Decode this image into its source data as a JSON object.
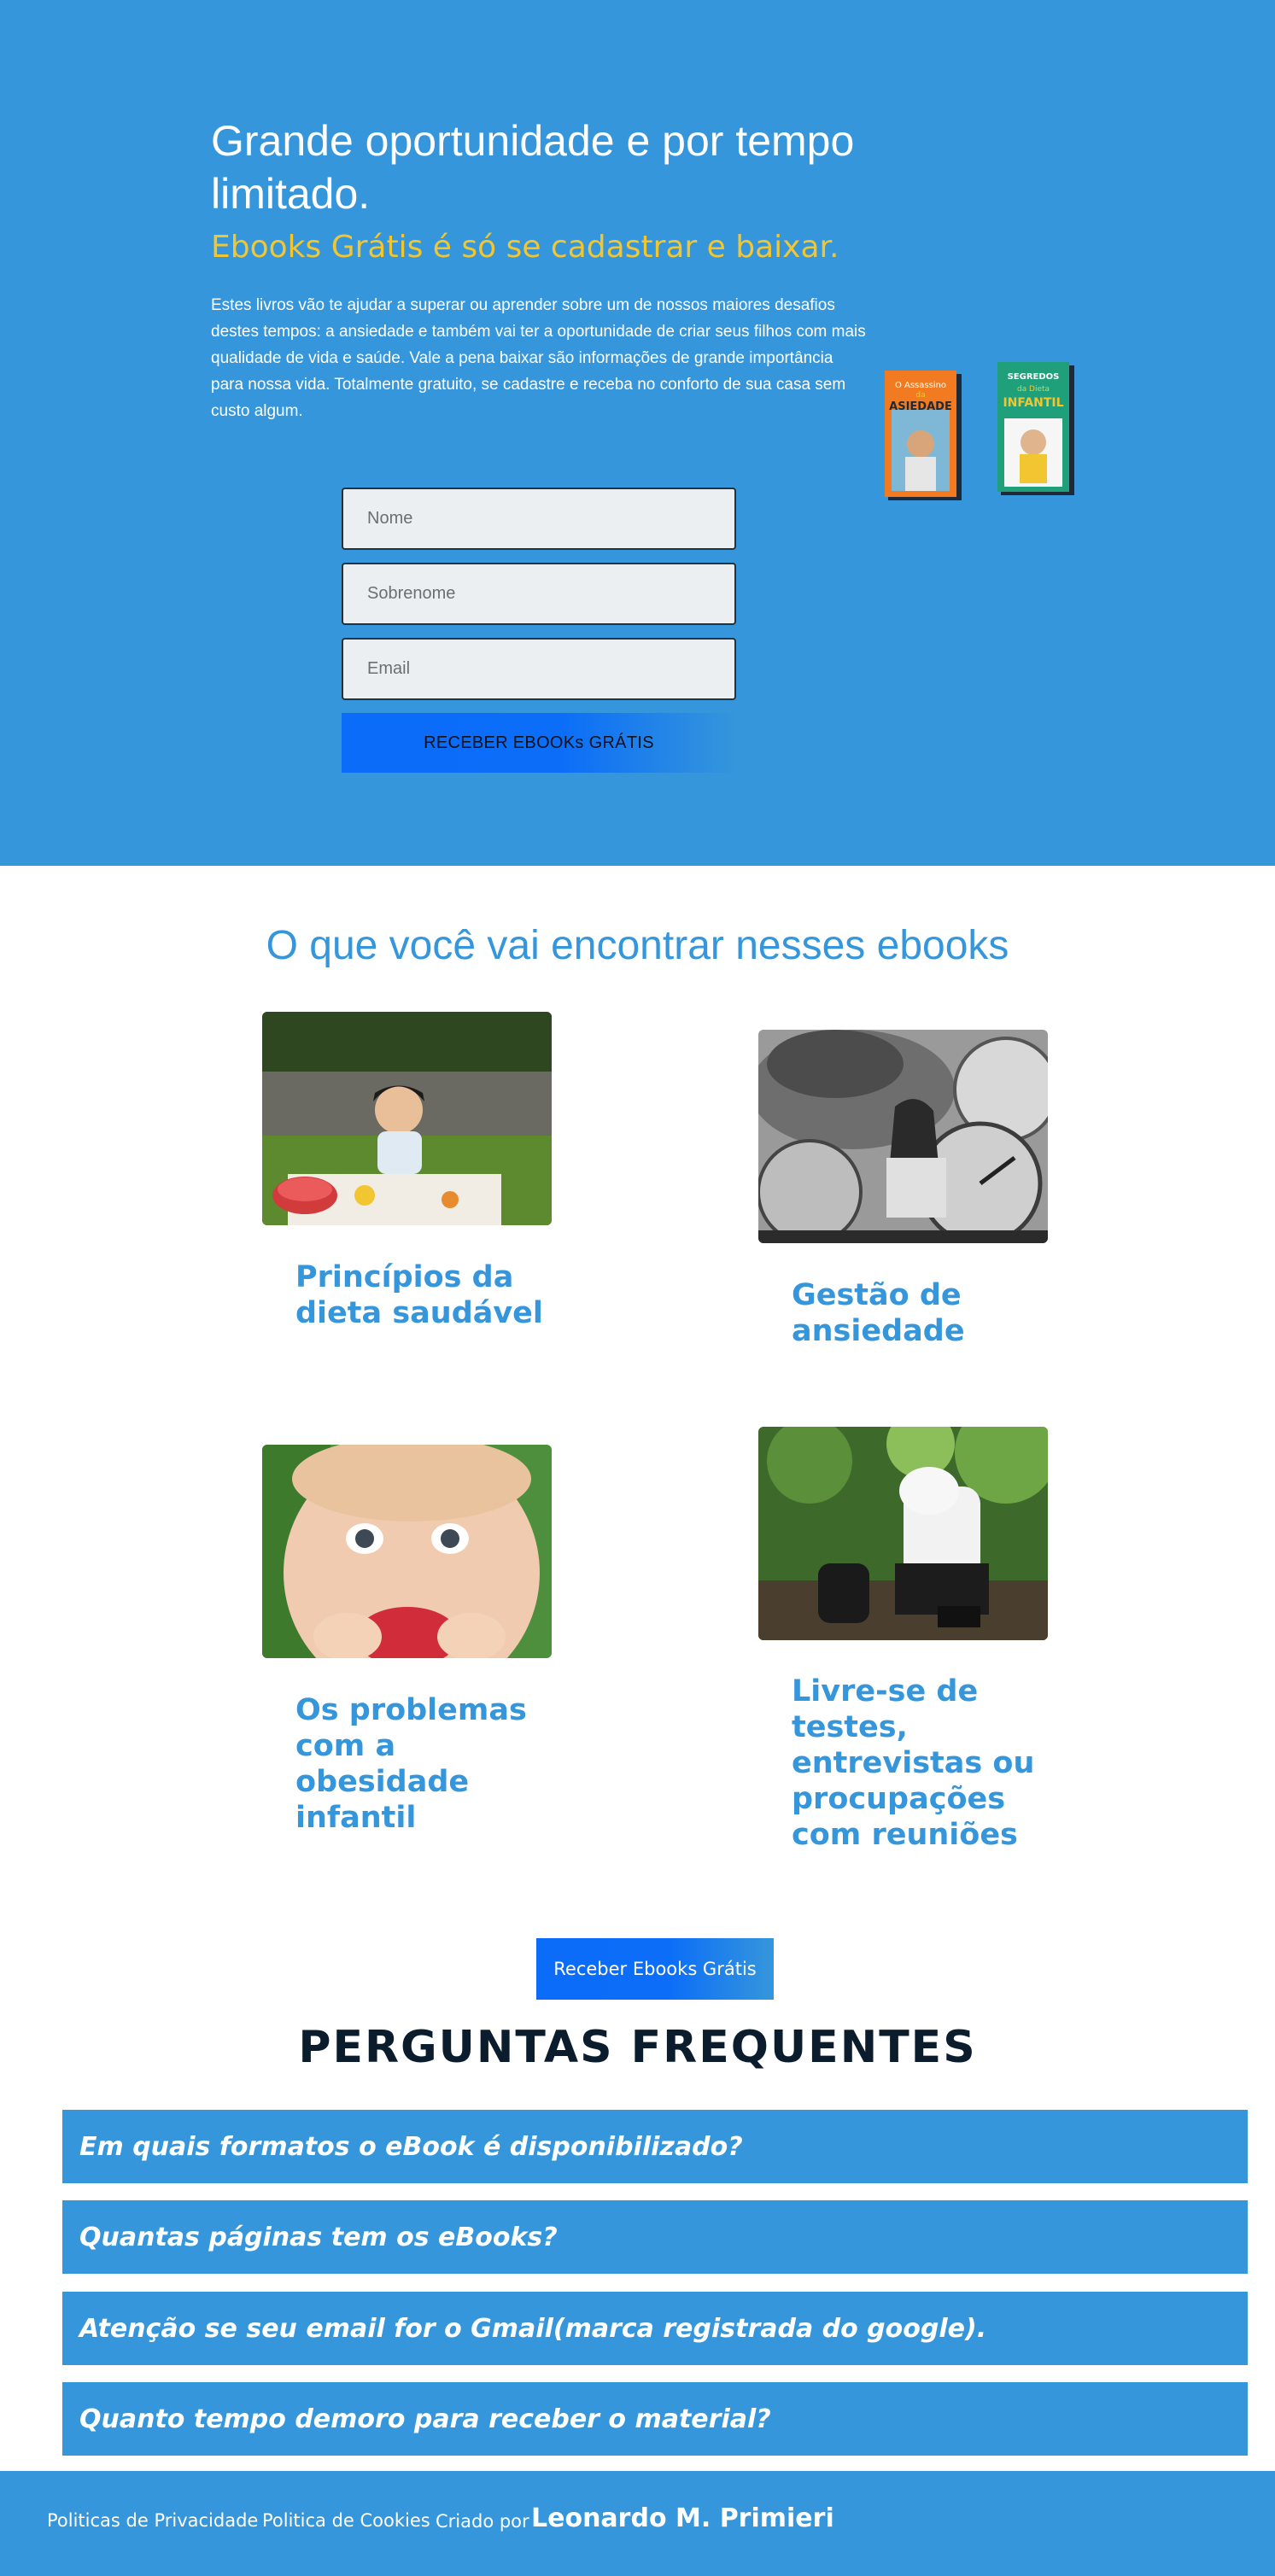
{
  "hero": {
    "title": "Grande oportunidade e por tempo limitado.",
    "subtitle": "Ebooks Grátis é só se cadastrar e baixar.",
    "text": "Estes livros vão te ajudar a superar ou aprender sobre um de nossos maiores desafios destes tempos: a ansiedade e também vai ter a oportunidade de criar seus filhos com mais qualidade de vida e saúde. Vale a pena baixar são informações de grande importância para nossa vida. Totalmente gratuito, se cadastre e receba no conforto de sua casa sem custo algum.",
    "books": [
      {
        "line1": "O Assassino",
        "line2": "da",
        "line3": "ASIEDADE"
      },
      {
        "line1": "SEGREDOS",
        "line2": "da Dieta",
        "line3": "INFANTIL"
      }
    ],
    "colors": {
      "background": "#3596db",
      "accent": "#f2c631"
    }
  },
  "form": {
    "name_placeholder": "Nome",
    "surname_placeholder": "Sobrenome",
    "email_placeholder": "Email",
    "submit_label": "RECEBER EBOOKs GRÁTIS"
  },
  "section": {
    "title": "O que você vai encontrar nesses ebooks",
    "cards": [
      {
        "title": "Princípios da dieta saudável",
        "image": "baby-picnic-photo"
      },
      {
        "title": "Gestão de ansiedade",
        "image": "anxious-woman-clocks-photo"
      },
      {
        "title": "Os problemas com a obesidade infantil",
        "image": "baby-eating-photo"
      },
      {
        "title": "Livre-se de testes, entrevistas ou procupações com reuniões",
        "image": "stressed-man-photo"
      }
    ],
    "cta_label": "Receber Ebooks Grátis"
  },
  "faq": {
    "title": "PERGUNTAS FREQUENTES",
    "items": [
      "Em quais formatos o eBook é disponibilizado?",
      "Quantas páginas tem os eBooks?",
      "Atenção se seu email for o Gmail(marca registrada do google).",
      "Quanto tempo demoro para receber o material?"
    ]
  },
  "footer": {
    "privacy": "Politicas de Privacidade",
    "cookies": "Politica de Cookies",
    "created_by": "Criado por",
    "author": "Leonardo M. Primieri"
  }
}
